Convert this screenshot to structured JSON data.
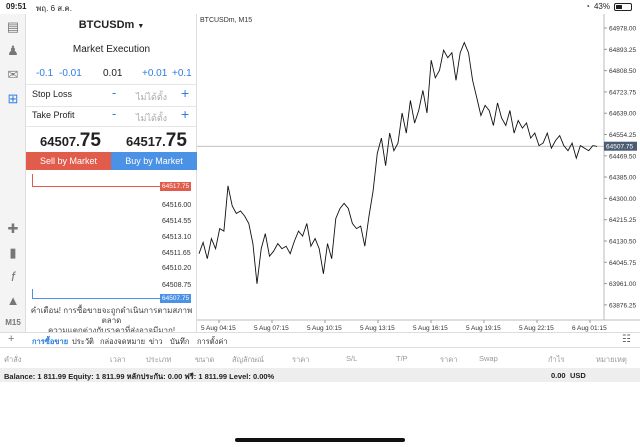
{
  "status": {
    "time": "09:51",
    "date": "พฤ. 6 ส.ค.",
    "battery": "43%"
  },
  "toolbar": {
    "icons": [
      "chart-type-icon",
      "profile-icon",
      "chat-icon",
      "new-order-icon",
      "crosshair-icon",
      "candles-icon",
      "indicator-icon",
      "objects-icon"
    ],
    "timeframe": "M15"
  },
  "order_panel": {
    "symbol": "BTCUSDm",
    "execution": "Market Execution",
    "volume_steps": [
      "-0.1",
      "-0.01",
      "0.01",
      "+0.01",
      "+0.1"
    ],
    "stop_loss_label": "Stop Loss",
    "take_profit_label": "Take Profit",
    "not_set": "ไม่ได้ตั้ง",
    "minus": "-",
    "plus": "+",
    "bid_main": "64507.",
    "bid_big": "75",
    "ask_main": "64517.",
    "ask_big": "75",
    "sell_label": "Sell by Market",
    "buy_label": "Buy by Market",
    "depth_prices": [
      "64517.75",
      "64516.00",
      "64514.55",
      "64513.10",
      "64511.65",
      "64510.20",
      "64508.75",
      "64507.75"
    ],
    "warning_line1": "คำเตือน! การซื้อขายจะถูกดำเนินการตามสภาพตลาด",
    "warning_line2": "ความแตกต่างกับราคาที่ส่งอาจมีมาก!"
  },
  "chart_data": {
    "type": "line",
    "title": "BTCUSDm, M15",
    "current_price": "64507.75",
    "y_ticks": [
      "64978.00",
      "64893.25",
      "64808.50",
      "64723.75",
      "64639.00",
      "64554.25",
      "64469.50",
      "64385.00",
      "64300.00",
      "64215.25",
      "64130.50",
      "64045.75",
      "63961.00",
      "63876.25"
    ],
    "x_ticks": [
      "5 Aug 04:15",
      "5 Aug 07:15",
      "5 Aug 10:15",
      "5 Aug 13:15",
      "5 Aug 16:15",
      "5 Aug 19:15",
      "5 Aug 22:15",
      "6 Aug 01:15"
    ],
    "ylim": [
      63840,
      65010
    ],
    "x": [
      0,
      1,
      2,
      3,
      4,
      5,
      6,
      7,
      8,
      9,
      10,
      11,
      12,
      13,
      14,
      15,
      16,
      17,
      18,
      19,
      20,
      21,
      22,
      23,
      24,
      25,
      26,
      27,
      28,
      29,
      30,
      31,
      32,
      33,
      34,
      35,
      36,
      37,
      38,
      39,
      40,
      41,
      42,
      43,
      44,
      45,
      46,
      47,
      48,
      49,
      50,
      51,
      52,
      53,
      54,
      55,
      56,
      57,
      58,
      59,
      60,
      61,
      62,
      63,
      64,
      65,
      66,
      67,
      68,
      69,
      70,
      71,
      72,
      73,
      74,
      75,
      76,
      77,
      78,
      79,
      80,
      81,
      82,
      83,
      84,
      85,
      86,
      87,
      88,
      89,
      90,
      91,
      92,
      93,
      94,
      95,
      96
    ],
    "values": [
      64080,
      64125,
      64060,
      64140,
      64100,
      64180,
      64170,
      64350,
      64270,
      64240,
      64250,
      64230,
      64200,
      64120,
      63960,
      64100,
      64160,
      64070,
      64090,
      64120,
      64100,
      64110,
      64080,
      64130,
      64170,
      64150,
      64200,
      64110,
      64140,
      64100,
      64000,
      64120,
      64060,
      64220,
      64260,
      64280,
      64260,
      64200,
      64180,
      64190,
      64110,
      64230,
      64330,
      64480,
      64540,
      64430,
      64560,
      64490,
      64520,
      64640,
      64560,
      64690,
      64600,
      64650,
      64730,
      64640,
      64850,
      64780,
      64810,
      64890,
      64860,
      64880,
      64770,
      64880,
      64920,
      64880,
      64770,
      64700,
      64630,
      64670,
      64650,
      64590,
      64680,
      64620,
      64590,
      64650,
      64560,
      64610,
      64580,
      64600,
      64540,
      64560,
      64510,
      64520,
      64560,
      64500,
      64530,
      64550,
      64510,
      64490,
      64520,
      64460,
      64510,
      64500,
      64490,
      64510,
      64507
    ]
  },
  "terminal": {
    "tabs": [
      "การซื้อขาย",
      "ประวัติ",
      "กล่องจดหมาย",
      "ข่าว",
      "บันทึก",
      "การตั้งค่า"
    ],
    "columns": [
      "คำสั่ง",
      "เวลา",
      "ประเภท",
      "ขนาด",
      "สัญลักษณ์",
      "ราคา",
      "S/L",
      "T/P",
      "ราคา",
      "Swap",
      "กำไร",
      "หมายเหตุ"
    ],
    "balance_line": "Balance: 1 811.99 Equity: 1 811.99 หลักประกัน: 0.00 ฟรี: 1 811.99 Level: 0.00%",
    "profit": "0.00",
    "currency": "USD"
  },
  "colors": {
    "sell": "#e25c4c",
    "buy": "#4b92e6",
    "accent": "#2f7de1"
  }
}
